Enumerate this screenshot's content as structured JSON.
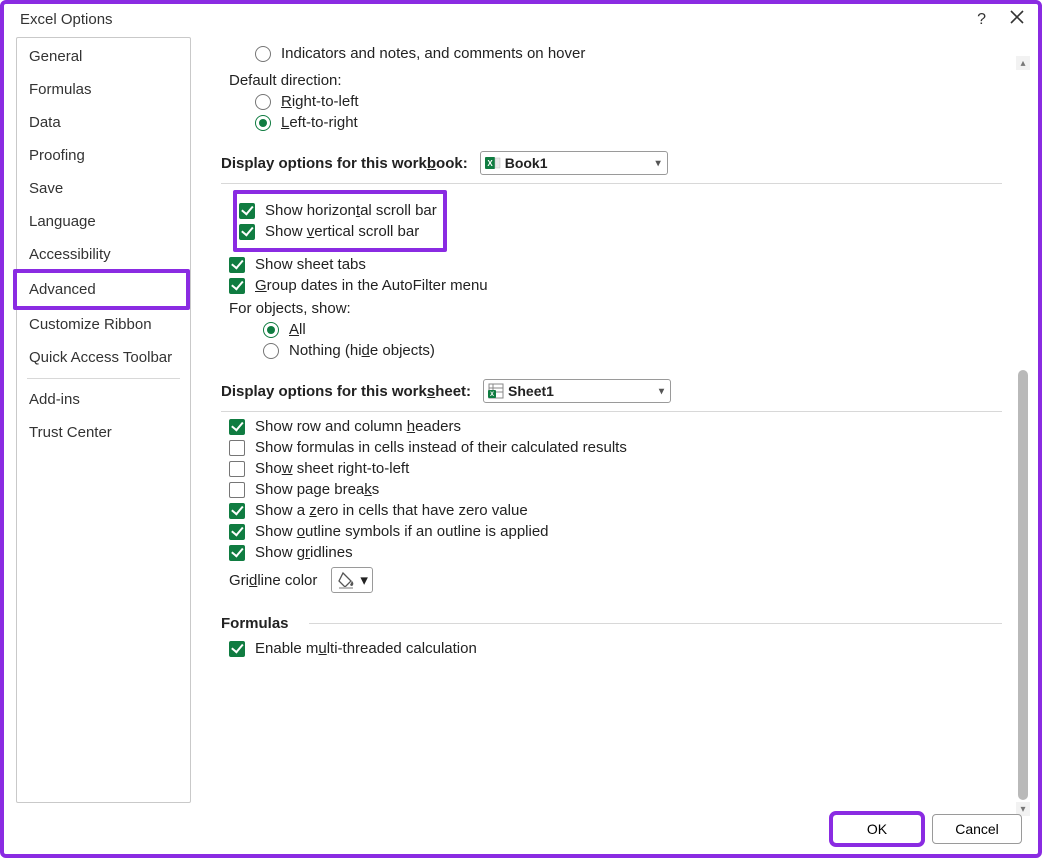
{
  "title": "Excel Options",
  "sidebar": {
    "items": [
      {
        "label": "General"
      },
      {
        "label": "Formulas"
      },
      {
        "label": "Data"
      },
      {
        "label": "Proofing"
      },
      {
        "label": "Save"
      },
      {
        "label": "Language"
      },
      {
        "label": "Accessibility"
      },
      {
        "label": "Advanced",
        "selected": true
      },
      {
        "label": "Customize Ribbon"
      },
      {
        "label": "Quick Access Toolbar"
      },
      {
        "label": "Add-ins"
      },
      {
        "label": "Trust Center"
      }
    ]
  },
  "top": {
    "indicators": "Indicators and notes, and comments on hover",
    "default_direction_label": "Default direction:",
    "rtl": "Right-to-left",
    "ltr": "Left-to-right"
  },
  "workbook": {
    "heading": "Display options for this workbook:",
    "dropdown": "Book1",
    "show_h_scroll": "Show horizontal scroll bar",
    "show_v_scroll": "Show vertical scroll bar",
    "show_sheet_tabs": "Show sheet tabs",
    "group_dates": "Group dates in the AutoFilter menu",
    "for_objects": "For objects, show:",
    "all": "All",
    "nothing": "Nothing (hide objects)"
  },
  "worksheet": {
    "heading": "Display options for this worksheet:",
    "dropdown": "Sheet1",
    "row_col_headers": "Show row and column headers",
    "formulas": "Show formulas in cells instead of their calculated results",
    "rtl_sheet": "Show sheet right-to-left",
    "page_breaks": "Show page breaks",
    "zero": "Show a zero in cells that have zero value",
    "outline": "Show outline symbols if an outline is applied",
    "gridlines": "Show gridlines",
    "gridline_color": "Gridline color"
  },
  "formulas_section": {
    "heading": "Formulas",
    "multithread": "Enable multi-threaded calculation"
  },
  "buttons": {
    "ok": "OK",
    "cancel": "Cancel"
  }
}
